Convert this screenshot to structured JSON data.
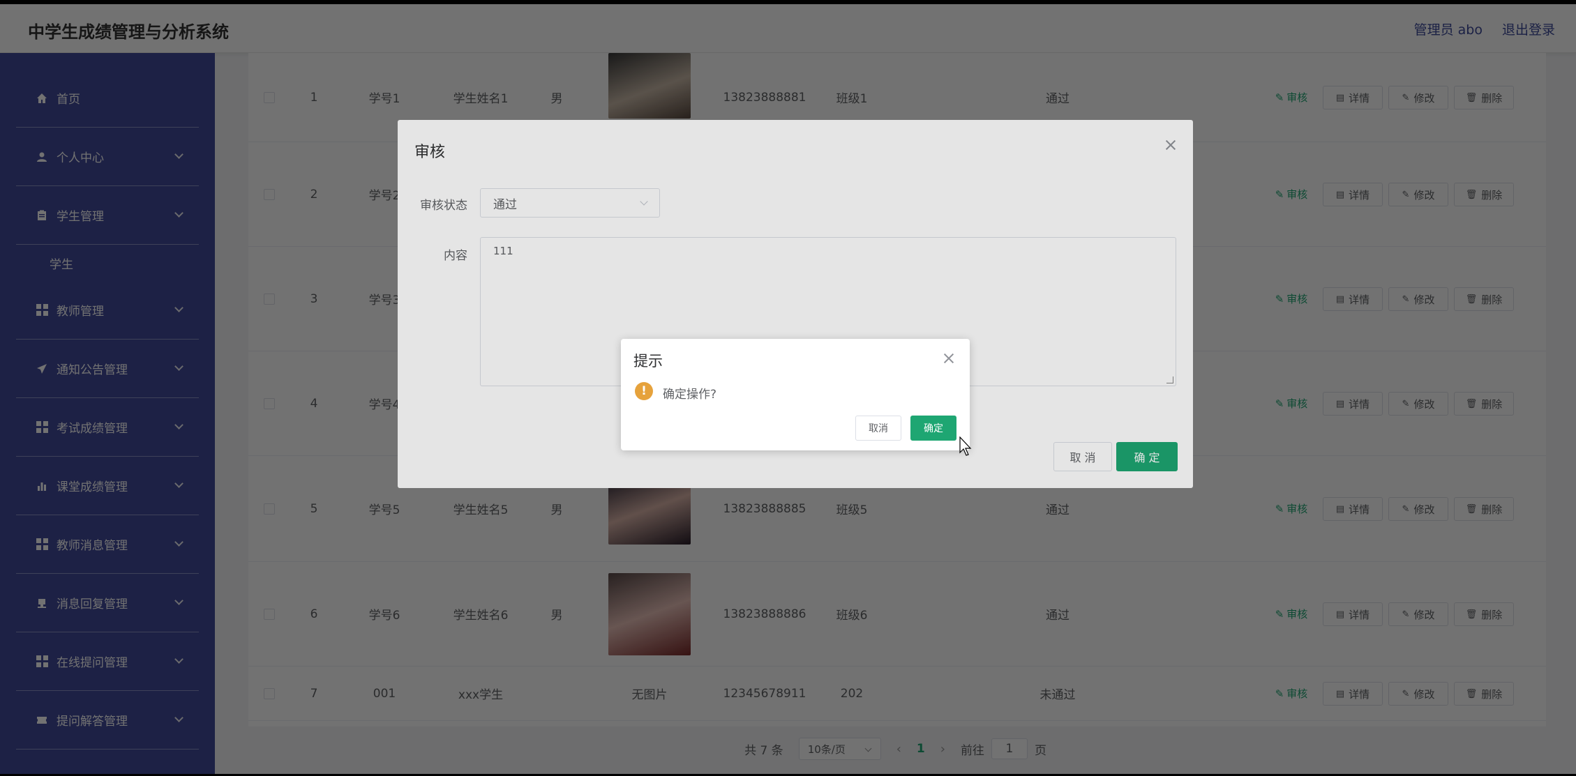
{
  "app": {
    "title": "中学生成绩管理与分析系统"
  },
  "header": {
    "admin": "管理员 abo",
    "logout": "退出登录"
  },
  "sidebar": {
    "items": [
      {
        "label": "首页",
        "icon": "home-icon"
      },
      {
        "label": "个人中心",
        "icon": "user-icon"
      },
      {
        "label": "学生管理",
        "icon": "clipboard-icon"
      },
      {
        "label": "学生",
        "icon": ""
      },
      {
        "label": "教师管理",
        "icon": "grid-icon"
      },
      {
        "label": "通知公告管理",
        "icon": "send-icon"
      },
      {
        "label": "考试成绩管理",
        "icon": "grid-icon"
      },
      {
        "label": "课堂成绩管理",
        "icon": "bar-chart-icon"
      },
      {
        "label": "教师消息管理",
        "icon": "grid-icon"
      },
      {
        "label": "消息回复管理",
        "icon": "stamp-icon"
      },
      {
        "label": "在线提问管理",
        "icon": "grid-icon"
      },
      {
        "label": "提问解答管理",
        "icon": "ticket-icon"
      }
    ]
  },
  "table": {
    "rows": [
      {
        "idx": "1",
        "sid": "学号1",
        "name": "学生姓名1",
        "gender": "男",
        "photo": "",
        "phone": "13823888881",
        "cls": "班级1",
        "status": "通过"
      },
      {
        "idx": "2",
        "sid": "学号2",
        "name": "",
        "gender": "",
        "photo": "",
        "phone": "",
        "cls": "",
        "status": ""
      },
      {
        "idx": "3",
        "sid": "学号3",
        "name": "",
        "gender": "",
        "photo": "",
        "phone": "",
        "cls": "",
        "status": ""
      },
      {
        "idx": "4",
        "sid": "学号4",
        "name": "",
        "gender": "",
        "photo": "",
        "phone": "",
        "cls": "",
        "status": ""
      },
      {
        "idx": "5",
        "sid": "学号5",
        "name": "学生姓名5",
        "gender": "男",
        "photo": "",
        "phone": "13823888885",
        "cls": "班级5",
        "status": "通过"
      },
      {
        "idx": "6",
        "sid": "学号6",
        "name": "学生姓名6",
        "gender": "男",
        "photo": "",
        "phone": "13823888886",
        "cls": "班级6",
        "status": "通过"
      },
      {
        "idx": "7",
        "sid": "001",
        "name": "xxx学生",
        "gender": "",
        "photo": "无图片",
        "phone": "12345678911",
        "cls": "202",
        "status": "未通过"
      }
    ],
    "audit_label": "审核",
    "detail_label": "详情",
    "edit_label": "修改",
    "delete_label": "删除"
  },
  "pager": {
    "total": "共 7 条",
    "size": "10条/页",
    "current": "1",
    "goto": "前往",
    "goto_value": "1",
    "page_unit": "页"
  },
  "audit_dialog": {
    "title": "审核",
    "status_label": "审核状态",
    "status_value": "通过",
    "content_label": "内容",
    "content_value": "111",
    "cancel": "取 消",
    "confirm": "确 定"
  },
  "confirm_dialog": {
    "title": "提示",
    "message": "确定操作?",
    "cancel": "取消",
    "confirm": "确定"
  },
  "colors": {
    "sidebar": "#434a9b",
    "accent": "#1ea672",
    "warning": "#e6a23c"
  }
}
